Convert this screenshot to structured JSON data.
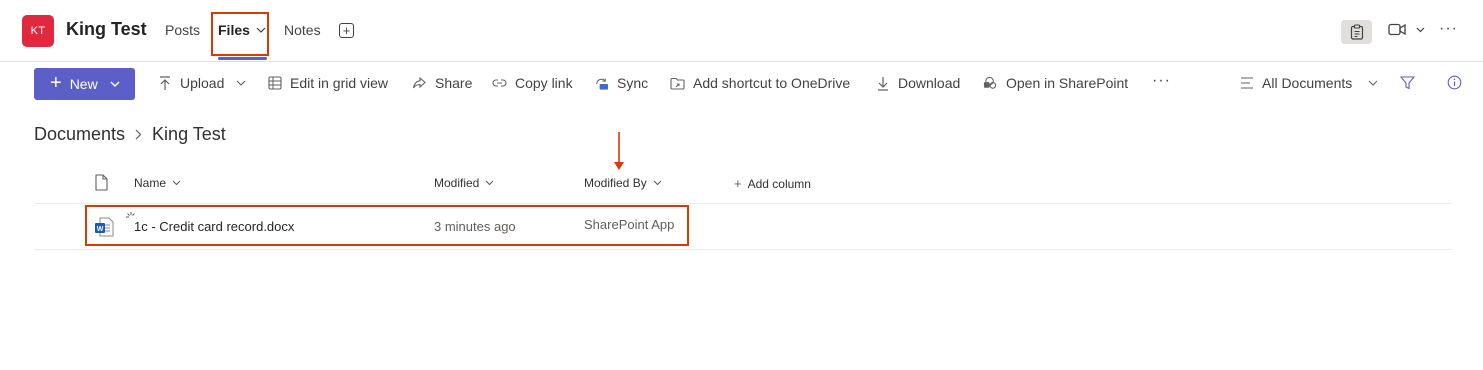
{
  "header": {
    "avatar_initials": "KT",
    "team_name": "King Test",
    "tabs": [
      {
        "label": "Posts",
        "active": false
      },
      {
        "label": "Files",
        "active": true
      },
      {
        "label": "Notes",
        "active": false
      }
    ],
    "add_tab_symbol": "+",
    "more_symbol": "···",
    "icons": [
      "clipboard-icon",
      "video-icon",
      "chevron-down-icon",
      "more-icon"
    ]
  },
  "commandbar": {
    "new_label": "New",
    "upload_label": "Upload",
    "grid_label": "Edit in grid view",
    "share_label": "Share",
    "copylink_label": "Copy link",
    "sync_label": "Sync",
    "shortcut_label": "Add shortcut to OneDrive",
    "download_label": "Download",
    "sharepoint_label": "Open in SharePoint",
    "more_symbol": "···",
    "view_label": "All Documents",
    "icons": [
      "upload-icon",
      "grid-icon",
      "share-icon",
      "link-icon",
      "sync-icon",
      "shortcut-icon",
      "download-icon",
      "sharepoint-icon",
      "list-view-icon",
      "filter-icon",
      "info-icon"
    ]
  },
  "breadcrumb": {
    "root": "Documents",
    "current": "King Test"
  },
  "table": {
    "columns": {
      "name": "Name",
      "modified": "Modified",
      "modified_by": "Modified By",
      "add_column": "Add column"
    },
    "rows": [
      {
        "name": "1c - Credit card record.docx",
        "modified": "3 minutes ago",
        "modified_by": "SharePoint App",
        "file_icon": "word-icon"
      }
    ]
  },
  "colors": {
    "accent": "#5b5fc7",
    "avatar": "#e0283e",
    "annotation": "#d83b01"
  }
}
